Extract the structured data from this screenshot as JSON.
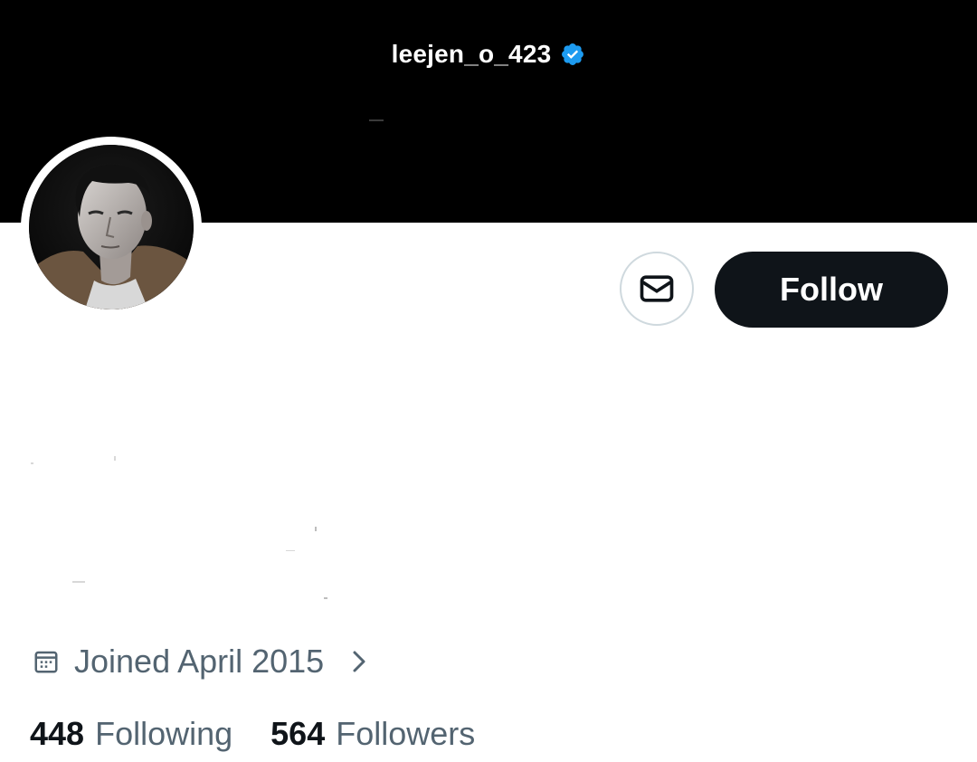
{
  "header": {
    "handle": "leejen_o_423",
    "verified_icon": "verified-badge-icon",
    "verified_color": "#1d9bf0"
  },
  "profile": {
    "avatar": "profile-photo"
  },
  "actions": {
    "message_icon": "envelope-icon",
    "follow_label": "Follow"
  },
  "meta": {
    "calendar_icon": "calendar-icon",
    "joined_text": "Joined April 2015",
    "chevron_icon": "chevron-right-icon"
  },
  "stats": {
    "following_count": "448",
    "following_label": "Following",
    "followers_count": "564",
    "followers_label": "Followers"
  },
  "colors": {
    "banner": "#000000",
    "primary_text": "#0f1419",
    "secondary_text": "#536471",
    "button_dark": "#0f1419",
    "border": "#cfd9de"
  }
}
